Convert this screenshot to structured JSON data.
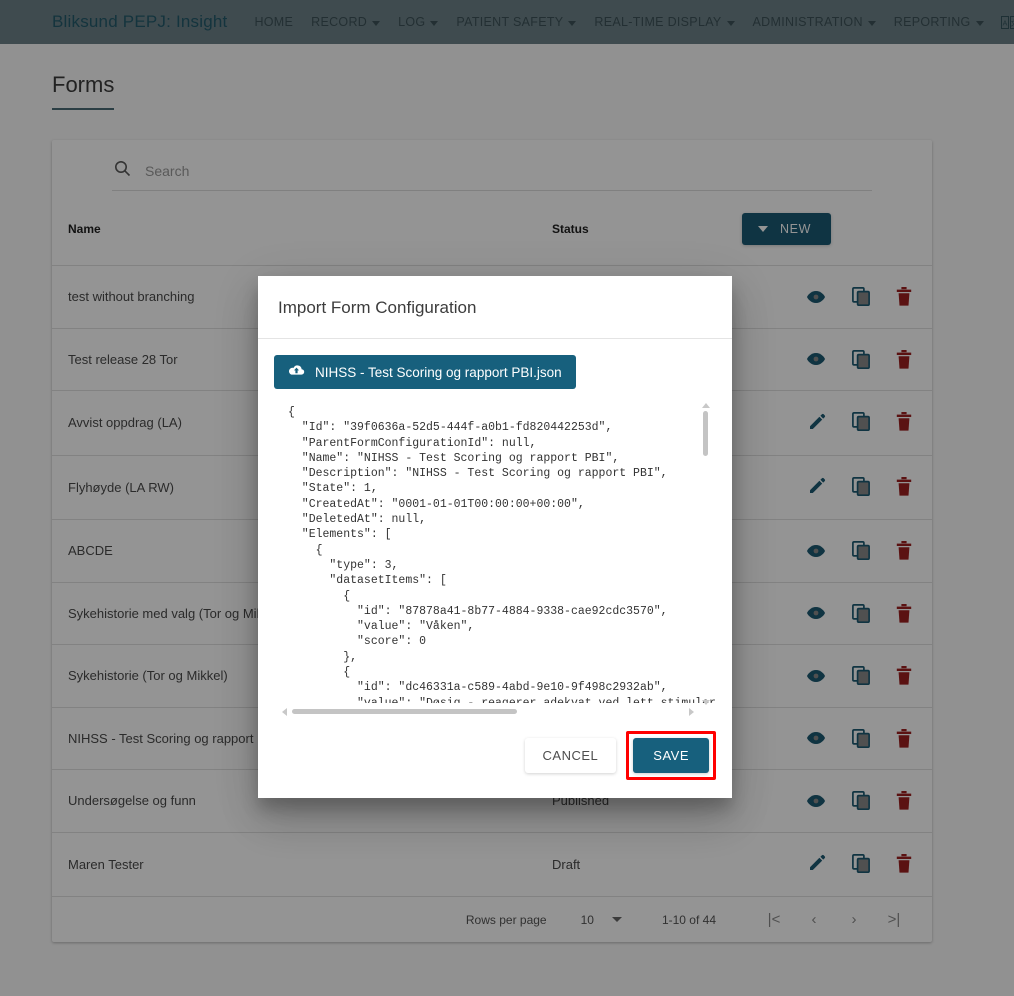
{
  "navbar": {
    "brand": "Bliksund PEPJ: Insight",
    "items": [
      {
        "label": "HOME",
        "has_caret": false
      },
      {
        "label": "RECORD",
        "has_caret": true
      },
      {
        "label": "LOG",
        "has_caret": true
      },
      {
        "label": "PATIENT SAFETY",
        "has_caret": true
      },
      {
        "label": "REAL-TIME DISPLAY",
        "has_caret": true
      },
      {
        "label": "ADMINISTRATION",
        "has_caret": true
      },
      {
        "label": "REPORTING",
        "has_caret": true
      }
    ],
    "icons": [
      {
        "name": "language-icon"
      },
      {
        "name": "logout-icon"
      }
    ]
  },
  "page": {
    "title": "Forms"
  },
  "search": {
    "placeholder": "Search",
    "value": "",
    "icon": "search-icon"
  },
  "table": {
    "columns": [
      "Name",
      "Status",
      ""
    ],
    "new_button": "NEW",
    "rows": [
      {
        "name": "test without branching",
        "status": "",
        "primary_icon": "eye-icon"
      },
      {
        "name": "Test release 28 Tor",
        "status": "",
        "primary_icon": "eye-icon"
      },
      {
        "name": "Avvist oppdrag (LA)",
        "status": "",
        "primary_icon": "pencil-icon"
      },
      {
        "name": "Flyhøyde (LA RW)",
        "status": "",
        "primary_icon": "pencil-icon"
      },
      {
        "name": "ABCDE",
        "status": "",
        "primary_icon": "eye-icon"
      },
      {
        "name": "Sykehistorie med valg (Tor og Mikkel)",
        "status": "",
        "primary_icon": "eye-icon"
      },
      {
        "name": "Sykehistorie (Tor og Mikkel)",
        "status": "",
        "primary_icon": "eye-icon"
      },
      {
        "name": "NIHSS - Test Scoring og rapport PBI",
        "status": "",
        "primary_icon": "eye-icon"
      },
      {
        "name": "Undersøgelse og funn",
        "status": "Published",
        "primary_icon": "eye-icon"
      },
      {
        "name": "Maren Tester",
        "status": "Draft",
        "primary_icon": "pencil-icon"
      }
    ],
    "row_action_icons": [
      "copy-icon",
      "delete-icon"
    ]
  },
  "pagination": {
    "rows_per_page_label": "Rows per page",
    "rows_per_page_value": "10",
    "range": "1-10 of 44",
    "first": "|<",
    "prev": "‹",
    "next": "›",
    "last": ">|"
  },
  "modal": {
    "title": "Import Form Configuration",
    "file_chip": "NIHSS - Test Scoring og rapport PBI.json",
    "file_chip_icon": "cloud-upload-icon",
    "json_text": "{\n  \"Id\": \"39f0636a-52d5-444f-a0b1-fd820442253d\",\n  \"ParentFormConfigurationId\": null,\n  \"Name\": \"NIHSS - Test Scoring og rapport PBI\",\n  \"Description\": \"NIHSS - Test Scoring og rapport PBI\",\n  \"State\": 1,\n  \"CreatedAt\": \"0001-01-01T00:00:00+00:00\",\n  \"DeletedAt\": null,\n  \"Elements\": [\n    {\n      \"type\": 3,\n      \"datasetItems\": [\n        {\n          \"id\": \"87878a41-8b77-4884-9338-cae92cdc3570\",\n          \"value\": \"Våken\",\n          \"score\": 0\n        },\n        {\n          \"id\": \"dc46331a-c589-4abd-9e10-9f498c2932ab\",\n          \"value\": \"Døsig - reagerer adekvat ved lett stimulering\",",
    "cancel_label": "CANCEL",
    "save_label": "SAVE"
  },
  "colors": {
    "navbar_bg": "#6d8288",
    "brand_text": "#245a6b",
    "accent_teal": "#17607d",
    "new_button": "#1b5b74",
    "delete_red": "#9e1f1f",
    "highlight_red": "#ff0000",
    "overlay": "rgba(0,0,0,0.42)"
  }
}
